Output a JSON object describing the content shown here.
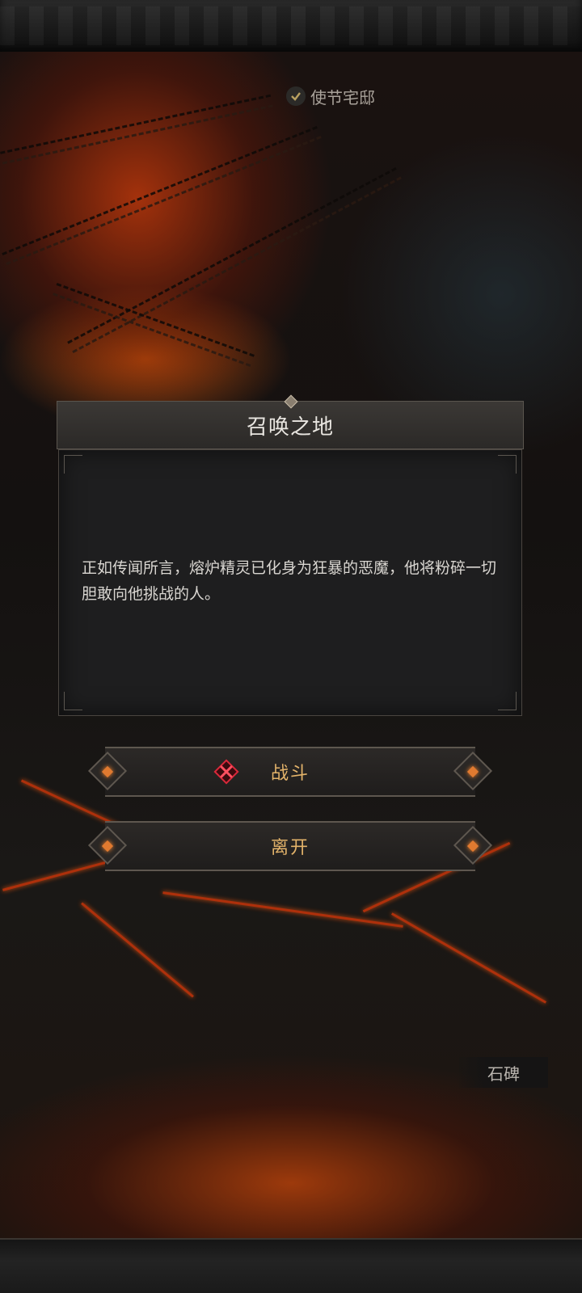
{
  "location": {
    "label": "使节宅邸",
    "icon": "check-icon"
  },
  "dialog": {
    "title": "召唤之地",
    "text": "正如传闻所言，熔炉精灵已化身为狂暴的恶魔，他将粉碎一切胆敢向他挑战的人。"
  },
  "actions": {
    "fight_label": "战斗",
    "leave_label": "离开"
  },
  "landmark": {
    "label": "石碑"
  },
  "colors": {
    "accent": "#e3b36a",
    "danger": "#d9283a",
    "lava": "#c8350a"
  }
}
